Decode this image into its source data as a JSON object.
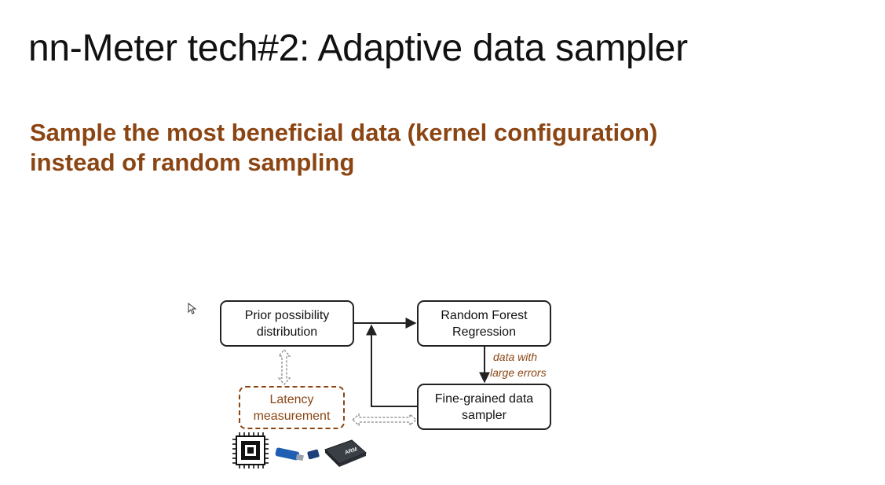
{
  "slide": {
    "title": "nn-Meter tech#2: Adaptive data sampler",
    "subtitle_lines": [
      "Sample the most beneficial data (kernel configuration)",
      "instead of random sampling"
    ]
  },
  "diagram": {
    "nodes": {
      "prior": {
        "lines": [
          "Prior possibility",
          "distribution"
        ]
      },
      "rf": {
        "lines": [
          "Random Forest",
          "Regression"
        ]
      },
      "sampler": {
        "lines": [
          "Fine-grained data",
          "sampler"
        ]
      },
      "latency": {
        "lines": [
          "Latency",
          "measurement"
        ]
      }
    },
    "edge_labels": {
      "rf_to_sampler": [
        "data with",
        "large errors"
      ]
    },
    "device_icons": [
      "cpu-chip-icon",
      "usb-accelerator-icon",
      "small-usb-dongle-icon",
      "arm-board-icon"
    ],
    "colors": {
      "accent": "#8B4513",
      "box_border": "#222222",
      "title": "#111111"
    }
  }
}
